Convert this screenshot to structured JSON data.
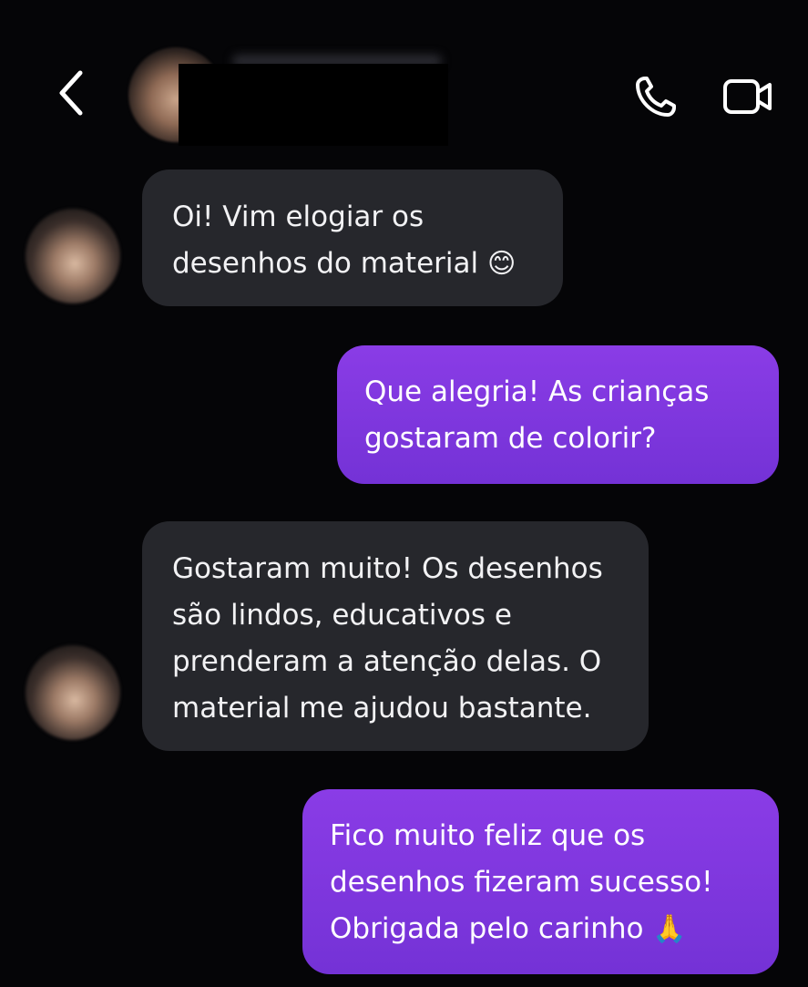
{
  "header": {
    "back_icon": "chevron-left-icon",
    "call_icon": "phone-icon",
    "video_icon": "video-camera-icon"
  },
  "messages": [
    {
      "direction": "incoming",
      "text": "Oi! Vim elogiar os\ndesenhos do material",
      "emoji": "😊"
    },
    {
      "direction": "outgoing",
      "text": "Que alegria! As crianças\ngostaram de colorir?"
    },
    {
      "direction": "incoming",
      "text": "Gostaram muito! Os desenhos\nsão lindos, educativos e\nprenderam a atenção delas. O\nmaterial me ajudou bastante."
    },
    {
      "direction": "outgoing",
      "text": "Fico muito feliz que os\ndesenhos fizeram sucesso!\nObrigada pelo carinho",
      "emoji": "🙏"
    }
  ],
  "colors": {
    "background": "#050507",
    "incoming_bubble": "#26272c",
    "outgoing_bubble": "#7d37dd",
    "text": "#f2f2f4"
  }
}
